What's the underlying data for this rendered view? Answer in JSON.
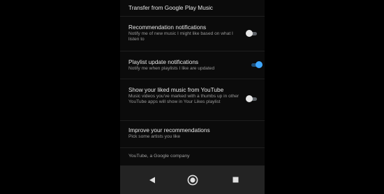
{
  "settings": {
    "transfer": {
      "title": "Transfer from Google Play Music"
    },
    "items": [
      {
        "title": "Recommendation notifications",
        "subtitle": "Notify me of new music I might like based on what I listen to",
        "toggle_on": false
      },
      {
        "title": "Playlist update notifications",
        "subtitle": "Notify me when playlists I like are updated",
        "toggle_on": true
      },
      {
        "title": "Show your liked music from YouTube",
        "subtitle": "Music videos you've marked with a thumbs up in other YouTube apps will show in Your Likes playlist",
        "toggle_on": false
      }
    ],
    "improve": {
      "title": "Improve your recommendations",
      "subtitle": "Pick some artists you like"
    },
    "footer": "YouTube, a Google company"
  },
  "navbar": {
    "buttons": [
      "back-icon",
      "home-icon",
      "recents-icon"
    ]
  },
  "colors": {
    "accent": "#3ea6ff",
    "background": "#0b0b0b",
    "navbar": "#232323"
  }
}
